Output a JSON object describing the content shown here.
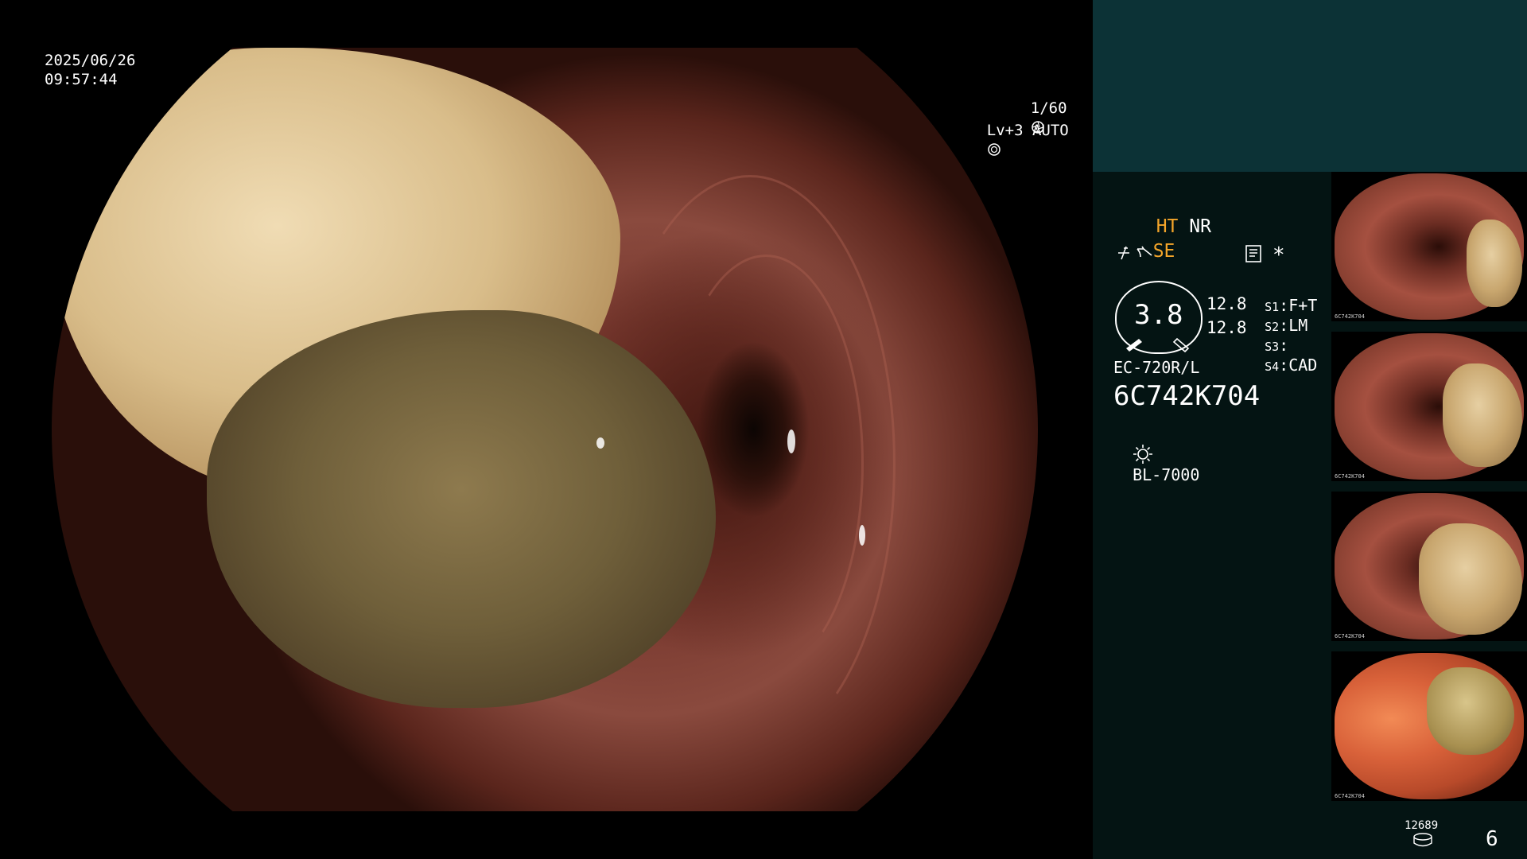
{
  "overlay": {
    "date": "2025/06/26",
    "time": "09:57:44",
    "shutter": "1/60",
    "shutter_icon": "iris-icon",
    "level": "Lv+3",
    "mode": "AUTO",
    "mode_icon": "auto-iris-icon"
  },
  "settings": {
    "ht": "HT",
    "nr": "NR",
    "se": "SE",
    "asterisk": "*",
    "gauge_value": "3.8",
    "value_top": "12.8",
    "value_bottom": "12.8",
    "switches": [
      {
        "key": "S1",
        "value": "F+T"
      },
      {
        "key": "S2",
        "value": "LM"
      },
      {
        "key": "S3",
        "value": ""
      },
      {
        "key": "S4",
        "value": "CAD"
      }
    ],
    "scope_model": "EC-720R/L",
    "serial": "6C742K704",
    "light_source": "BL-7000"
  },
  "thumbnails": [
    {
      "label": "6C742K704"
    },
    {
      "label": "6C742K704"
    },
    {
      "label": "6C742K704"
    },
    {
      "label": "6C742K704"
    }
  ],
  "footer": {
    "counter": "12689",
    "image_count": "6"
  },
  "colors": {
    "accent": "#f4a52a",
    "panel": "#041413",
    "panel_top": "#0c3236"
  }
}
